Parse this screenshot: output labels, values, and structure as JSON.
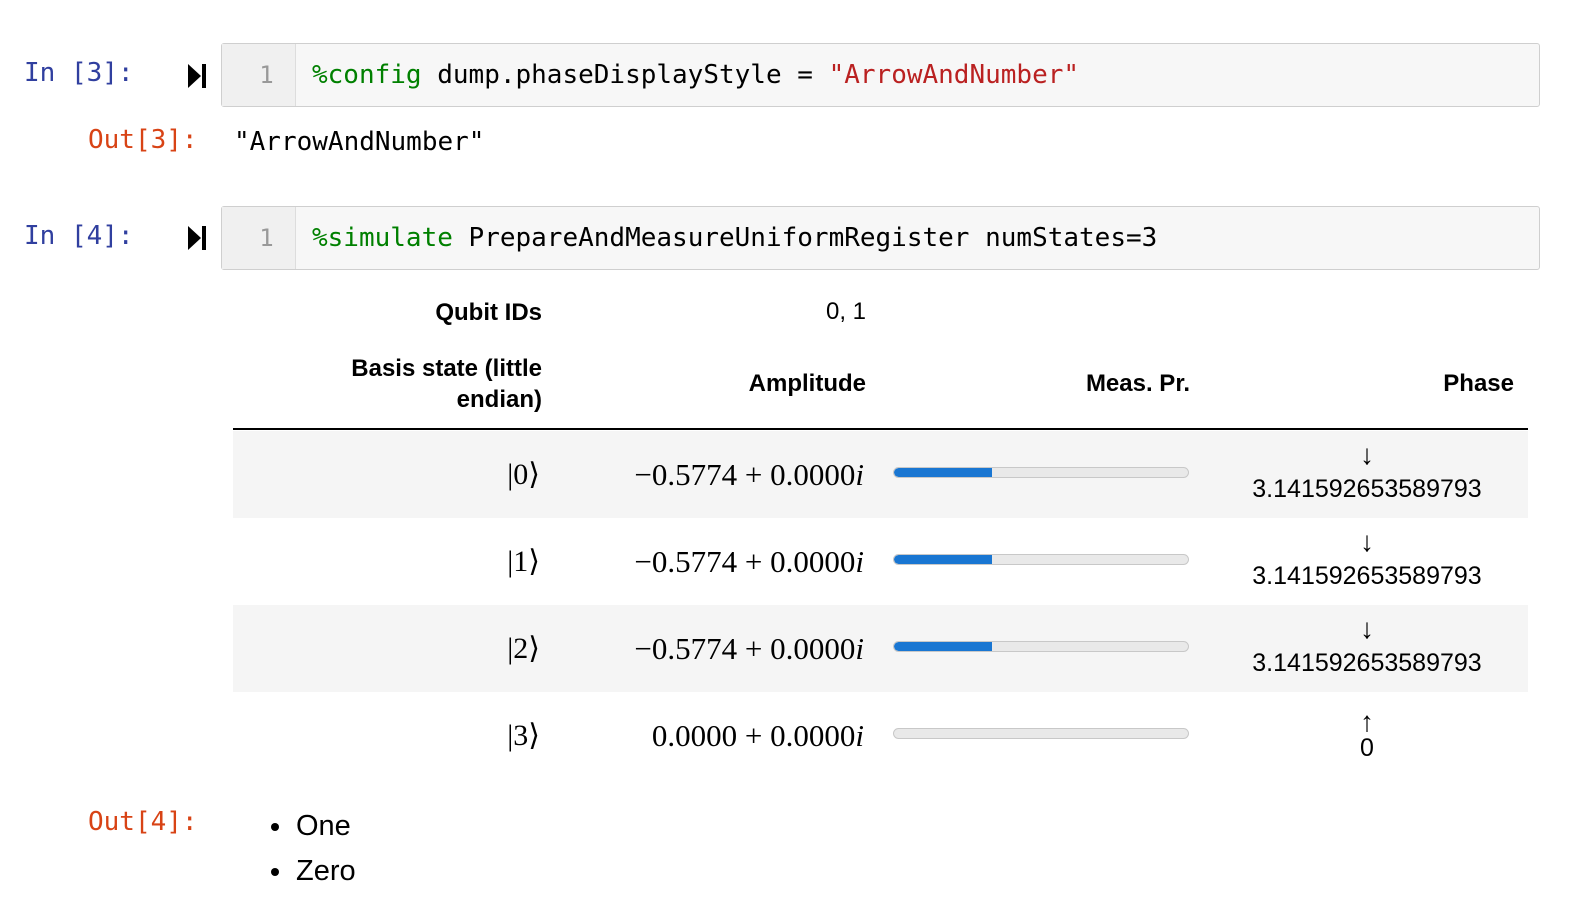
{
  "cells": [
    {
      "in_prompt": "In [3]:",
      "line_number": "1",
      "code_magic": "%config",
      "code_rest": " dump.phaseDisplayStyle = ",
      "code_string": "\"ArrowAndNumber\"",
      "out_prompt": "Out[3]:",
      "output": "\"ArrowAndNumber\""
    },
    {
      "in_prompt": "In [4]:",
      "line_number": "1",
      "code_magic": "%simulate",
      "code_rest": " PrepareAndMeasureUniformRegister numStates=3",
      "out_prompt": "Out[4]:"
    }
  ],
  "table": {
    "qubit_ids_label": "Qubit IDs",
    "qubit_ids_value": "0, 1",
    "headers": {
      "basis_line1": "Basis state (little",
      "basis_line2": "endian)",
      "amplitude": "Amplitude",
      "meas_pr": "Meas. Pr.",
      "phase": "Phase"
    },
    "rows": [
      {
        "basis": "|0⟩",
        "amplitude": "−0.5774 + 0.0000i",
        "probability": 0.3333,
        "phase_arrow": "↓",
        "phase_value": "3.141592653589793"
      },
      {
        "basis": "|1⟩",
        "amplitude": "−0.5774 + 0.0000i",
        "probability": 0.3333,
        "phase_arrow": "↓",
        "phase_value": "3.141592653589793"
      },
      {
        "basis": "|2⟩",
        "amplitude": "−0.5774 + 0.0000i",
        "probability": 0.3333,
        "phase_arrow": "↓",
        "phase_value": "3.141592653589793"
      },
      {
        "basis": "|3⟩",
        "amplitude": "0.0000 + 0.0000i",
        "probability": 0.0,
        "phase_arrow": "↑",
        "phase_value": "0"
      }
    ],
    "bar_color": "#1976d2"
  },
  "result_list": [
    "One",
    "Zero"
  ],
  "colors": {
    "in_prompt": "#303f9f",
    "out_prompt": "#d84315",
    "magic": "#008000",
    "string": "#ba2121"
  }
}
